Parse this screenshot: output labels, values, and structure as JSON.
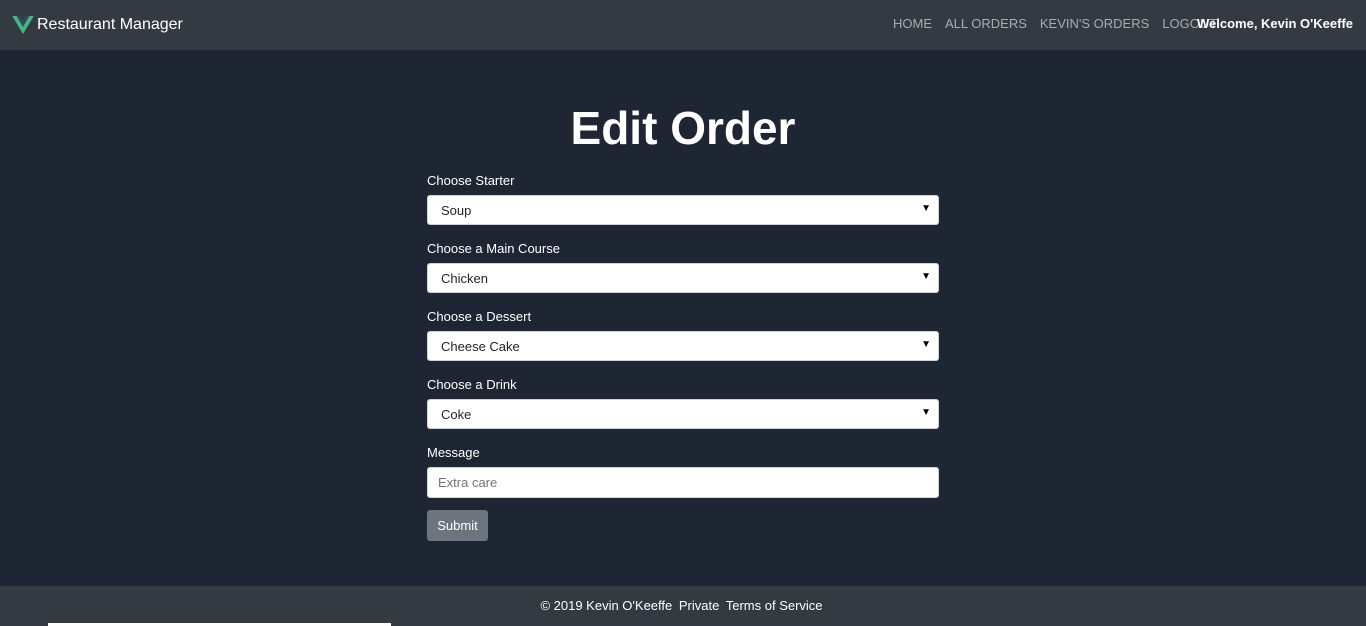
{
  "navbar": {
    "brand": "Restaurant Manager",
    "brand_color": "#41b883",
    "links": [
      "HOME",
      "ALL ORDERS",
      "KEVIN'S ORDERS",
      "LOGOUT"
    ],
    "welcome": "Welcome, Kevin O'Keeffe"
  },
  "page": {
    "title": "Edit Order"
  },
  "form": {
    "starter_label": "Choose Starter",
    "starter_value": "Soup",
    "main_label": "Choose a Main Course",
    "main_value": "Chicken",
    "dessert_label": "Choose a Dessert",
    "dessert_value": "Cheese Cake",
    "drink_label": "Choose a Drink",
    "drink_value": "Coke",
    "message_label": "Message",
    "message_placeholder": "Extra care",
    "submit_label": "Submit"
  },
  "footer": {
    "copyright": "© 2019 Kevin O'Keeffe",
    "private": "Private",
    "terms": "Terms of Service"
  },
  "icons": {
    "caret": "caret-down-icon",
    "logo": "vue-logo-icon"
  }
}
